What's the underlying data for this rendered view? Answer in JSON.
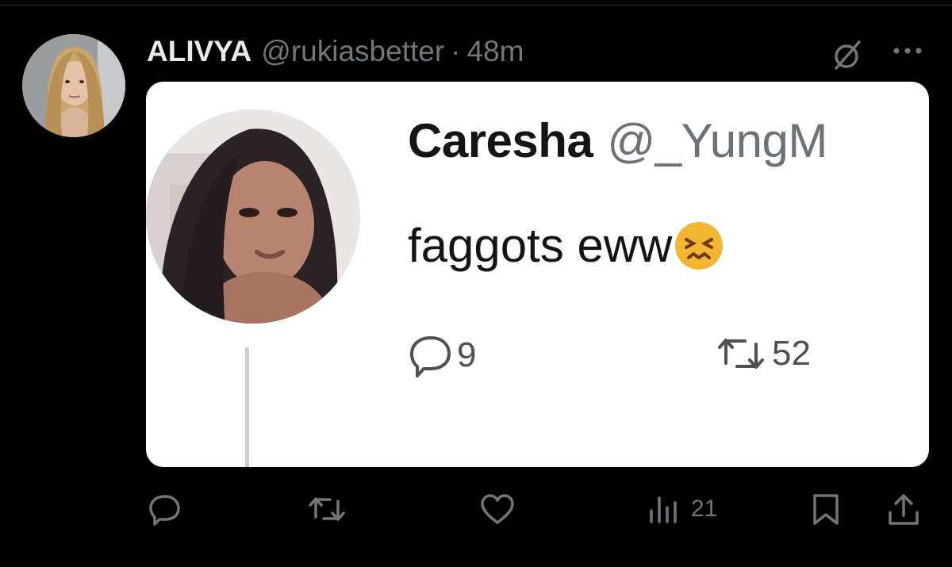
{
  "tweet": {
    "display_name": "ALIVYA",
    "handle": "@rukiasbetter",
    "separator": "·",
    "time": "48m",
    "avatar": "profile-photo-woman-blonde"
  },
  "quoted_screenshot": {
    "display_name": "Caresha",
    "handle": "@_YungM",
    "text": "faggots eww",
    "emoji": "confounded-face-emoji",
    "reply_count": "9",
    "retweet_count": "52"
  },
  "actions": {
    "views": "21"
  },
  "icons": [
    "grok-icon",
    "more-icon",
    "reply-icon",
    "retweet-icon",
    "like-icon",
    "views-icon",
    "bookmark-icon",
    "share-icon"
  ],
  "colors": {
    "background": "#000000",
    "secondary_text": "#71767b",
    "primary_text": "#e7e9ea",
    "card": "#ffffff"
  }
}
